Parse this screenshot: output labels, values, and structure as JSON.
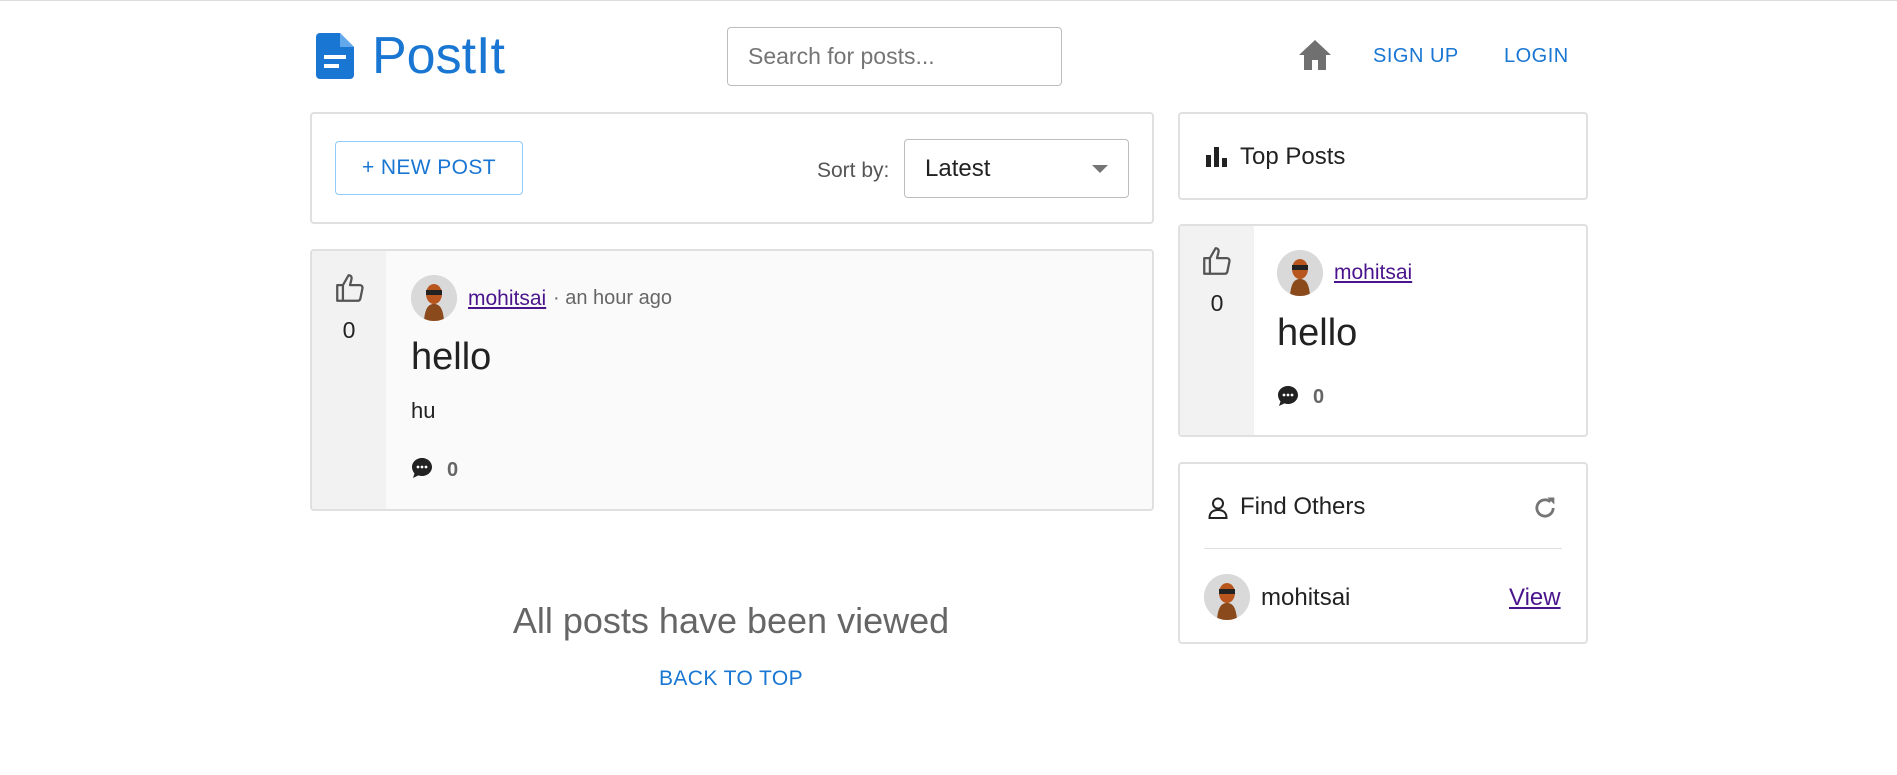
{
  "header": {
    "logo_text": "PostIt",
    "search_placeholder": "Search for posts...",
    "nav": {
      "signup": "SIGN UP",
      "login": "LOGIN"
    },
    "icons": {
      "logo": "document-icon",
      "home": "home-icon"
    }
  },
  "toolbar": {
    "new_post": "+ NEW POST",
    "sort_label": "Sort by:",
    "sort_value": "Latest"
  },
  "posts": [
    {
      "votes": "0",
      "author": "mohitsai",
      "time": "· an hour ago",
      "title": "hello",
      "body": "hu",
      "comments": "0"
    }
  ],
  "top_posts": {
    "title": "Top Posts",
    "items": [
      {
        "votes": "0",
        "author": "mohitsai",
        "title": "hello",
        "comments": "0"
      }
    ]
  },
  "find_others": {
    "title": "Find Others",
    "users": [
      {
        "name": "mohitsai",
        "action": "View"
      }
    ]
  },
  "footer": {
    "end_message": "All posts have been viewed",
    "back_to_top": "BACK TO TOP"
  },
  "colors": {
    "primary": "#1976d2",
    "visited_link": "#4a148c",
    "muted": "#666666"
  }
}
